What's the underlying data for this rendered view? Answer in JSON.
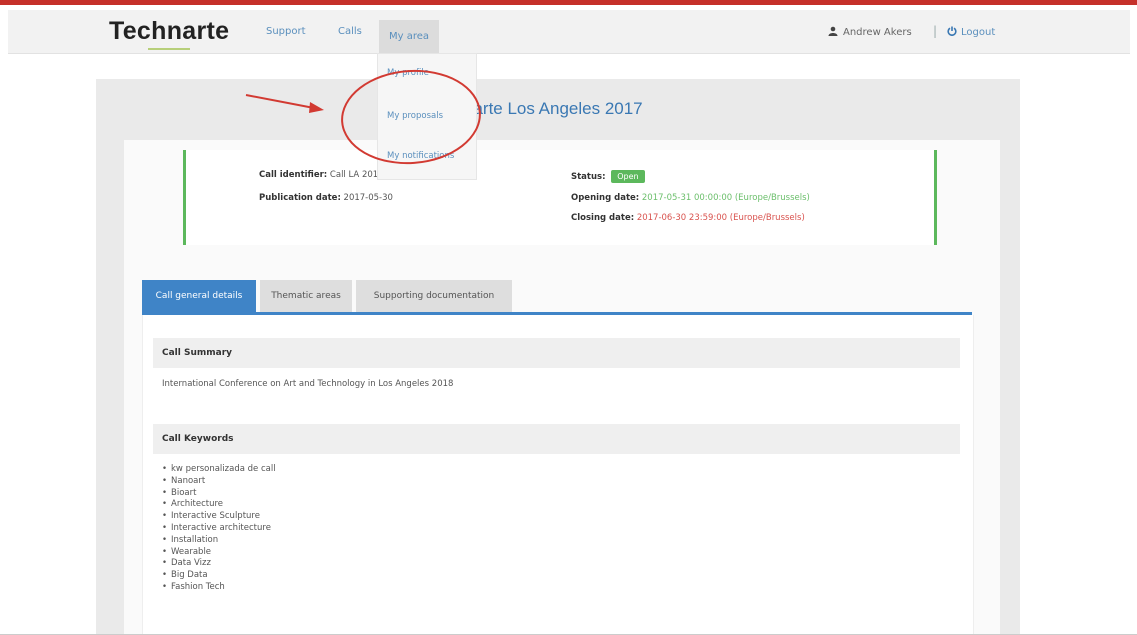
{
  "navbar": {
    "brand": "Technarte",
    "items": [
      {
        "label": "Support"
      },
      {
        "label": "Calls"
      },
      {
        "label": "My area"
      }
    ],
    "user": {
      "icon": "user-icon",
      "name": "Andrew Akers"
    },
    "separator": "|",
    "logout": {
      "icon": "power-icon",
      "label": "Logout"
    }
  },
  "dropdown": {
    "items": [
      {
        "label": "My profile"
      },
      {
        "label": "My proposals"
      },
      {
        "label": "My notifications"
      }
    ]
  },
  "page": {
    "title": "narte Los Angeles 2017"
  },
  "call_info": {
    "identifier_label": "Call identifier:",
    "identifier_value": "Call LA 2017",
    "publication_label": "Publication date:",
    "publication_value": "2017-05-30",
    "status_label": "Status:",
    "status_value": "Open",
    "opening_label": "Opening date:",
    "opening_value": "2017-05-31 00:00:00 (Europe/Brussels)",
    "closing_label": "Closing date:",
    "closing_value": "2017-06-30 23:59:00 (Europe/Brussels)",
    "colors": {
      "open": "#5cb85c",
      "closing": "#d9534f"
    }
  },
  "tabs": [
    {
      "label": "Call general details",
      "active": true
    },
    {
      "label": "Thematic areas",
      "active": false
    },
    {
      "label": "Supporting documentation",
      "active": false
    }
  ],
  "summary": {
    "heading": "Call Summary",
    "text": "International Conference on Art and Technology in Los Angeles 2018"
  },
  "keywords": {
    "heading": "Call Keywords",
    "items": [
      "kw personalizada de call",
      "Nanoart",
      "Bioart",
      "Architecture",
      "Interactive Sculpture",
      "Interactive architecture",
      "Installation",
      "Wearable",
      "Data Vizz",
      "Big Data",
      "Fashion Tech"
    ]
  },
  "colors": {
    "accent": "#3f84c7",
    "brand_bar": "#c5302a",
    "annotation": "#d23a32"
  }
}
